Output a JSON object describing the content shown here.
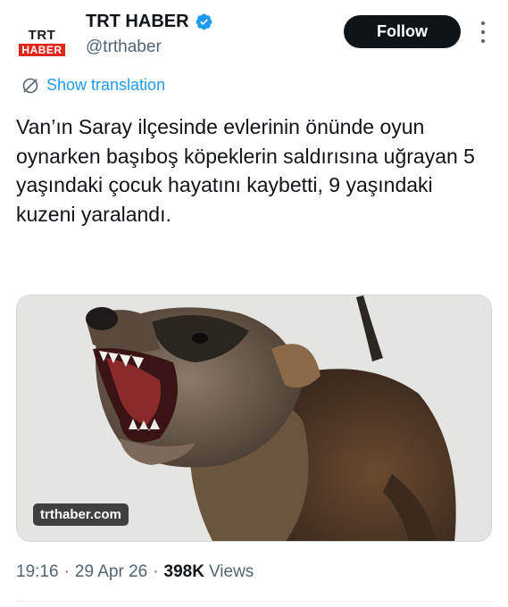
{
  "account": {
    "display_name": "TRT HABER",
    "handle": "@trthaber",
    "avatar_logo_top": "TRT",
    "avatar_logo_bottom": "HABER",
    "verified": true
  },
  "actions": {
    "follow_label": "Follow"
  },
  "translation": {
    "label": "Show translation"
  },
  "tweet": {
    "text": "Van’ın Saray ilçesinde evlerinin önünde oyun oynarken başıboş köpeklerin saldırısına uğrayan 5 yaşındaki çocuk hayatını kaybetti, 9 yaşındaki kuzeni yaralandı."
  },
  "media": {
    "source_badge": "trthaber.com",
    "subject": "snarling dog"
  },
  "meta": {
    "time": "19:16",
    "date": "29 Apr 26",
    "views_count": "398K",
    "views_label": "Views",
    "separator": "·"
  },
  "colors": {
    "link": "#1d9bf0",
    "verified": "#1d9bf0",
    "secondary_text": "#536471",
    "brand_red": "#e1251b"
  },
  "icons": {
    "verified": "verified-badge-icon",
    "translate": "globe-slash-icon",
    "more": "more-vertical-icon"
  }
}
